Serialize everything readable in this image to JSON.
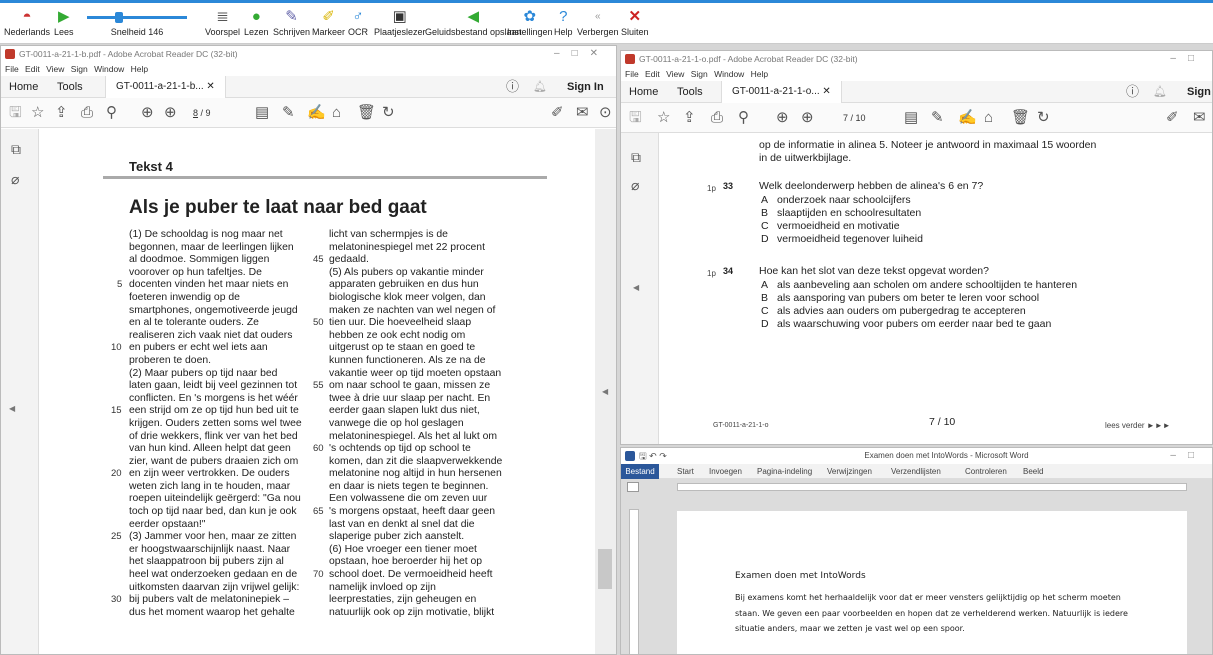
{
  "toolbar": {
    "items": [
      {
        "label": "Nederlands",
        "icon": "flag-icon"
      },
      {
        "label": "Lees",
        "icon": "play-icon"
      },
      {
        "label": "Snelheid 146",
        "icon": "speed-slider-icon"
      },
      {
        "label": "Voorspel",
        "icon": "list-icon"
      },
      {
        "label": "Lezen",
        "icon": "read-icon"
      },
      {
        "label": "Schrijven",
        "icon": "write-icon"
      },
      {
        "label": "Markeer",
        "icon": "highlight-icon"
      },
      {
        "label": "OCR",
        "icon": "ocr-icon"
      },
      {
        "label": "Plaatjeslezer",
        "icon": "image-reader-icon"
      },
      {
        "label": "Geluidsbestand opslaan",
        "icon": "save-audio-icon"
      },
      {
        "label": "Instellingen",
        "icon": "settings-icon"
      },
      {
        "label": "Help",
        "icon": "help-icon"
      },
      {
        "label": "Verbergen",
        "icon": "hide-icon"
      },
      {
        "label": "Sluiten",
        "icon": "close-icon"
      }
    ]
  },
  "left": {
    "title": "GT-0011-a-21-1-b.pdf - Adobe Acrobat Reader DC (32-bit)",
    "menu": "File Edit View Sign Window Help",
    "home": "Home",
    "tools": "Tools",
    "tab": "GT-0011-a-21-1-b...",
    "signin": "Sign In",
    "page_current": "8",
    "page_total": "/ 9",
    "tekst": "Tekst 4",
    "headline": "Als je puber te laat naar bed gaat",
    "col1": "(1) De schooldag is nog maar net\nbegonnen, maar de leerlingen lijken\nal doodmoe. Sommigen liggen\nvoorover op hun tafeltjes. De\ndocenten vinden het maar niets en\nfoeteren inwendig op de\nsmartphones, ongemotiveerde jeugd\nen al te tolerante ouders. Ze\nrealiseren zich vaak niet dat ouders\nen pubers er echt wel iets aan\nproberen te doen.\n(2) Maar pubers op tijd naar bed\nlaten gaan, leidt bij veel gezinnen tot\nconflicten. En 's morgens is het wéér\neen strijd om ze op tijd hun bed uit te\nkrijgen. Ouders zetten soms wel twee\nof drie wekkers, flink ver van het bed\nvan hun kind. Alleen helpt dat geen\nzier, want de pubers draaien zich om\nen zijn weer vertrokken. De ouders\nweten zich lang in te houden, maar\nroepen uiteindelijk geërgerd: \"Ga nou\ntoch op tijd naar bed, dan kun je ook\neerder opstaan!\"\n(3) Jammer voor hen, maar ze zitten\ner hoogstwaarschijnlijk naast. Naar\nhet slaappatroon bij pubers zijn al\nheel wat onderzoeken gedaan en de\nuitkomsten daarvan zijn vrijwel gelijk:\nbij pubers valt de melatoninepiek –\ndus het moment waarop het gehalte",
    "col2": "licht van schermpjes is de\nmelatoninespiegel met 22 procent\ngedaald.\n(5) Als pubers op vakantie minder\napparaten gebruiken en dus hun\nbiologische klok meer volgen, dan\nmaken ze nachten van wel negen of\ntien uur. Die hoeveelheid slaap\nhebben ze ook echt nodig om\nuitgerust op te staan en goed te\nkunnen functioneren. Als ze na de\nvakantie weer op tijd moeten opstaan\nom naar school te gaan, missen ze\ntwee à drie uur slaap per nacht. En\neerder gaan slapen lukt dus niet,\nvanwege die op hol geslagen\nmelatoninespiegel. Als het al lukt om\n's ochtends op tijd op school te\nkomen, dan zit die slaapverwekkende\nmelatonine nog altijd in hun hersenen\nen daar is niets tegen te beginnen.\nEen volwassene die om zeven uur\n's morgens opstaat, heeft daar geen\nlast van en denkt al snel dat die\nslaperige puber zich aanstelt.\n(6) Hoe vroeger een tiener moet\nopstaan, hoe beroerder hij het op\nschool doet. De vermoeidheid heeft\nnamelijk invloed op zijn\nleerprestaties, zijn geheugen en\nnatuurlijk ook op zijn motivatie, blijkt",
    "linenums1": [
      "5",
      "10",
      "15",
      "20",
      "25",
      "30"
    ],
    "linenums2": [
      "45",
      "50",
      "55",
      "60",
      "65",
      "70"
    ]
  },
  "right": {
    "title": "GT-0011-a-21-1-o.pdf - Adobe Acrobat Reader DC (32-bit)",
    "menu": "File Edit View Sign Window Help",
    "home": "Home",
    "tools": "Tools",
    "tab": "GT-0011-a-21-1-o...",
    "signin": "Sign",
    "page_current": "7",
    "page_total": "/ 10",
    "intro1": "op de informatie in alinea 5. Noteer je antwoord in maximaal 15 woorden",
    "intro2": "in de uitwerkbijlage.",
    "q33_pts": "1p",
    "q33_num": "33",
    "q33": "Welk deelonderwerp hebben de alinea's 6 en 7?",
    "q33_opts": [
      [
        "A",
        "onderzoek naar schoolcijfers"
      ],
      [
        "B",
        "slaaptijden en schoolresultaten"
      ],
      [
        "C",
        "vermoeidheid en motivatie"
      ],
      [
        "D",
        "vermoeidheid tegenover luiheid"
      ]
    ],
    "q34_pts": "1p",
    "q34_num": "34",
    "q34": "Hoe kan het slot van deze tekst opgevat worden?",
    "q34_opts": [
      [
        "A",
        "als aanbeveling aan scholen om andere schooltijden te hanteren"
      ],
      [
        "B",
        "als aansporing van pubers om beter te leren voor school"
      ],
      [
        "C",
        "als advies aan ouders om pubergedrag te accepteren"
      ],
      [
        "D",
        "als waarschuwing voor pubers om eerder naar bed te gaan"
      ]
    ],
    "footer_code": "GT-0011-a-21-1-o",
    "footer_page": "7 / 10",
    "footer_next": "lees verder ►►►"
  },
  "word": {
    "title": "Examen doen met IntoWords - Microsoft Word",
    "tabs": [
      "Bestand",
      "Start",
      "Invoegen",
      "Pagina-indeling",
      "Verwijzingen",
      "Verzendlijsten",
      "Controleren",
      "Beeld"
    ],
    "heading": "Examen doen met IntoWords",
    "body1": "Bij examens komt het herhaaldelijk voor dat er meer vensters gelijktijdig op het scherm moeten",
    "body2": "staan. We geven een paar voorbeelden en hopen dat ze verhelderend werken. Natuurlijk is iedere",
    "body3": "situatie anders, maar we zetten je vast wel op een spoor."
  },
  "colors": {
    "accent": "#2b88d8",
    "word_blue": "#2b579a"
  }
}
